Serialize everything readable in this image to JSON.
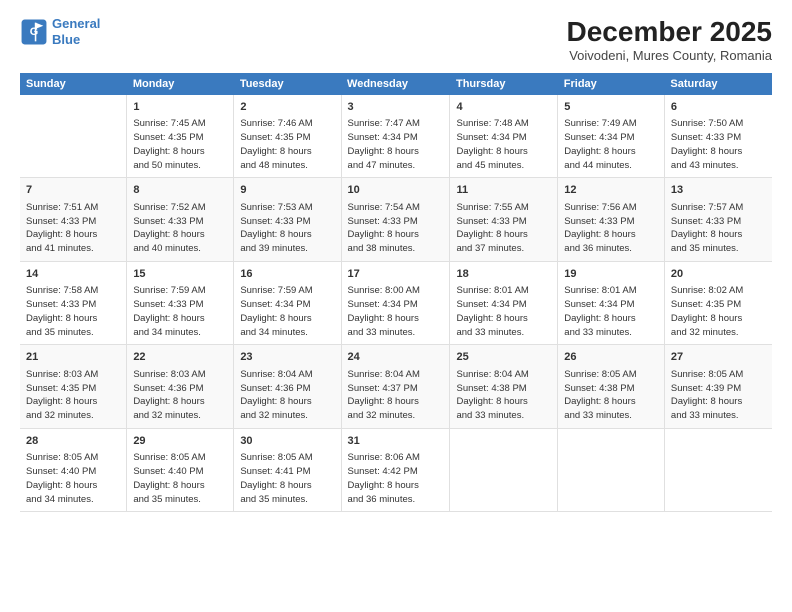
{
  "header": {
    "logo_line1": "General",
    "logo_line2": "Blue",
    "month": "December 2025",
    "location": "Voivodeni, Mures County, Romania"
  },
  "days_of_week": [
    "Sunday",
    "Monday",
    "Tuesday",
    "Wednesday",
    "Thursday",
    "Friday",
    "Saturday"
  ],
  "weeks": [
    [
      {
        "day": "",
        "info": ""
      },
      {
        "day": "1",
        "info": "Sunrise: 7:45 AM\nSunset: 4:35 PM\nDaylight: 8 hours\nand 50 minutes."
      },
      {
        "day": "2",
        "info": "Sunrise: 7:46 AM\nSunset: 4:35 PM\nDaylight: 8 hours\nand 48 minutes."
      },
      {
        "day": "3",
        "info": "Sunrise: 7:47 AM\nSunset: 4:34 PM\nDaylight: 8 hours\nand 47 minutes."
      },
      {
        "day": "4",
        "info": "Sunrise: 7:48 AM\nSunset: 4:34 PM\nDaylight: 8 hours\nand 45 minutes."
      },
      {
        "day": "5",
        "info": "Sunrise: 7:49 AM\nSunset: 4:34 PM\nDaylight: 8 hours\nand 44 minutes."
      },
      {
        "day": "6",
        "info": "Sunrise: 7:50 AM\nSunset: 4:33 PM\nDaylight: 8 hours\nand 43 minutes."
      }
    ],
    [
      {
        "day": "7",
        "info": "Sunrise: 7:51 AM\nSunset: 4:33 PM\nDaylight: 8 hours\nand 41 minutes."
      },
      {
        "day": "8",
        "info": "Sunrise: 7:52 AM\nSunset: 4:33 PM\nDaylight: 8 hours\nand 40 minutes."
      },
      {
        "day": "9",
        "info": "Sunrise: 7:53 AM\nSunset: 4:33 PM\nDaylight: 8 hours\nand 39 minutes."
      },
      {
        "day": "10",
        "info": "Sunrise: 7:54 AM\nSunset: 4:33 PM\nDaylight: 8 hours\nand 38 minutes."
      },
      {
        "day": "11",
        "info": "Sunrise: 7:55 AM\nSunset: 4:33 PM\nDaylight: 8 hours\nand 37 minutes."
      },
      {
        "day": "12",
        "info": "Sunrise: 7:56 AM\nSunset: 4:33 PM\nDaylight: 8 hours\nand 36 minutes."
      },
      {
        "day": "13",
        "info": "Sunrise: 7:57 AM\nSunset: 4:33 PM\nDaylight: 8 hours\nand 35 minutes."
      }
    ],
    [
      {
        "day": "14",
        "info": "Sunrise: 7:58 AM\nSunset: 4:33 PM\nDaylight: 8 hours\nand 35 minutes."
      },
      {
        "day": "15",
        "info": "Sunrise: 7:59 AM\nSunset: 4:33 PM\nDaylight: 8 hours\nand 34 minutes."
      },
      {
        "day": "16",
        "info": "Sunrise: 7:59 AM\nSunset: 4:34 PM\nDaylight: 8 hours\nand 34 minutes."
      },
      {
        "day": "17",
        "info": "Sunrise: 8:00 AM\nSunset: 4:34 PM\nDaylight: 8 hours\nand 33 minutes."
      },
      {
        "day": "18",
        "info": "Sunrise: 8:01 AM\nSunset: 4:34 PM\nDaylight: 8 hours\nand 33 minutes."
      },
      {
        "day": "19",
        "info": "Sunrise: 8:01 AM\nSunset: 4:34 PM\nDaylight: 8 hours\nand 33 minutes."
      },
      {
        "day": "20",
        "info": "Sunrise: 8:02 AM\nSunset: 4:35 PM\nDaylight: 8 hours\nand 32 minutes."
      }
    ],
    [
      {
        "day": "21",
        "info": "Sunrise: 8:03 AM\nSunset: 4:35 PM\nDaylight: 8 hours\nand 32 minutes."
      },
      {
        "day": "22",
        "info": "Sunrise: 8:03 AM\nSunset: 4:36 PM\nDaylight: 8 hours\nand 32 minutes."
      },
      {
        "day": "23",
        "info": "Sunrise: 8:04 AM\nSunset: 4:36 PM\nDaylight: 8 hours\nand 32 minutes."
      },
      {
        "day": "24",
        "info": "Sunrise: 8:04 AM\nSunset: 4:37 PM\nDaylight: 8 hours\nand 32 minutes."
      },
      {
        "day": "25",
        "info": "Sunrise: 8:04 AM\nSunset: 4:38 PM\nDaylight: 8 hours\nand 33 minutes."
      },
      {
        "day": "26",
        "info": "Sunrise: 8:05 AM\nSunset: 4:38 PM\nDaylight: 8 hours\nand 33 minutes."
      },
      {
        "day": "27",
        "info": "Sunrise: 8:05 AM\nSunset: 4:39 PM\nDaylight: 8 hours\nand 33 minutes."
      }
    ],
    [
      {
        "day": "28",
        "info": "Sunrise: 8:05 AM\nSunset: 4:40 PM\nDaylight: 8 hours\nand 34 minutes."
      },
      {
        "day": "29",
        "info": "Sunrise: 8:05 AM\nSunset: 4:40 PM\nDaylight: 8 hours\nand 35 minutes."
      },
      {
        "day": "30",
        "info": "Sunrise: 8:05 AM\nSunset: 4:41 PM\nDaylight: 8 hours\nand 35 minutes."
      },
      {
        "day": "31",
        "info": "Sunrise: 8:06 AM\nSunset: 4:42 PM\nDaylight: 8 hours\nand 36 minutes."
      },
      {
        "day": "",
        "info": ""
      },
      {
        "day": "",
        "info": ""
      },
      {
        "day": "",
        "info": ""
      }
    ]
  ]
}
